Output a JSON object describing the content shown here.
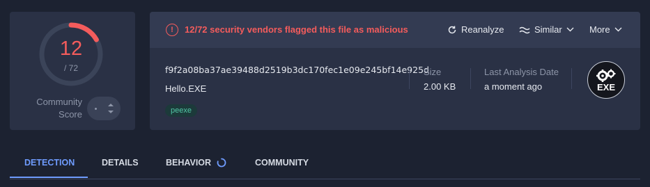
{
  "score": {
    "detections": "12",
    "total": "/ 72",
    "fraction": 0.1667,
    "label_line1": "Community",
    "label_line2": "Score",
    "accent": "#f45c5c"
  },
  "alert": {
    "icon": "alert-circle-icon",
    "text": "12/72 security vendors flagged this file as malicious"
  },
  "actions": {
    "reanalyze": "Reanalyze",
    "similar": "Similar",
    "more": "More"
  },
  "file": {
    "hash": "f9f2a08ba37ae39488d2519b3dc170fec1e09e245bf14e925d",
    "name": "Hello.EXE",
    "tag": "peexe",
    "size_label": "Size",
    "size_value": "2.00 KB",
    "analysis_label": "Last Analysis Date",
    "analysis_value": "a moment ago",
    "type_badge": "EXE"
  },
  "tabs": [
    {
      "label": "DETECTION",
      "active": true
    },
    {
      "label": "DETAILS",
      "active": false
    },
    {
      "label": "BEHAVIOR",
      "active": false,
      "loading": true
    },
    {
      "label": "COMMUNITY",
      "active": false
    }
  ]
}
